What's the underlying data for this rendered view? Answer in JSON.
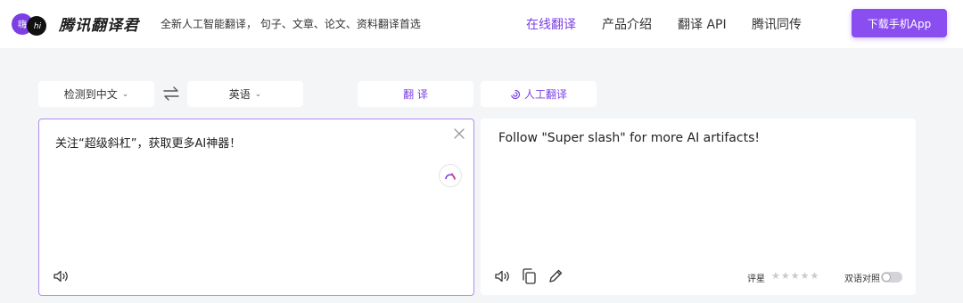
{
  "header": {
    "logo_left_text": "嗨",
    "logo_right_text": "hi",
    "brand_name": "腾讯翻译君",
    "slogan": "全新人工智能翻译， 句子、文章、论文、资料翻译首选",
    "nav": [
      {
        "label": "在线翻译",
        "active": true
      },
      {
        "label": "产品介绍",
        "active": false
      },
      {
        "label": "翻译 API",
        "active": false
      },
      {
        "label": "腾讯同传",
        "active": false
      }
    ],
    "download_label": "下载手机App"
  },
  "toolbar": {
    "source_lang": "检测到中文",
    "target_lang": "英语",
    "translate_label": "翻 译",
    "human_translate_label": "人工翻译"
  },
  "source_panel": {
    "text": "关注“超级斜杠”，获取更多AI神器！"
  },
  "target_panel": {
    "text": "Follow \"Super slash\" for more AI artifacts!",
    "rating_label": "评星",
    "rating_value": 0,
    "rating_max": 5,
    "bilingual_label": "双语对照",
    "bilingual_on": false
  },
  "colors": {
    "accent": "#7b3fe4",
    "button": "#8a4df0",
    "background": "#f4f5f7"
  }
}
